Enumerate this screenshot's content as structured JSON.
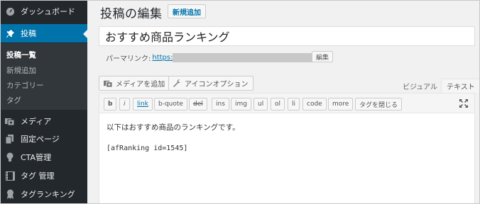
{
  "sidebar": {
    "dashboard": "ダッシュボード",
    "posts": "投稿",
    "sub": [
      "投稿一覧",
      "新規追加",
      "カテゴリー",
      "タグ"
    ],
    "media": "メディア",
    "pages": "固定ページ",
    "cta": "CTA管理",
    "tags": "タグ 管理",
    "tag_ranking": "タグランキング"
  },
  "header": {
    "title": "投稿の編集",
    "add_new": "新規追加"
  },
  "post": {
    "title": "おすすめ商品ランキング",
    "permalink_label": "パーマリンク:",
    "permalink_url": "https:",
    "edit_button": "編集"
  },
  "editor": {
    "add_media": "メディアを追加",
    "icon_option": "アイコンオプション",
    "tab_visual": "ビジュアル",
    "tab_text": "テキスト",
    "quicktags": [
      "b",
      "i",
      "link",
      "b-quote",
      "del",
      "ins",
      "img",
      "ul",
      "ol",
      "li",
      "code",
      "more",
      "タグを閉じる"
    ],
    "content_line1": "以下はおすすめ商品のランキングです。",
    "content_line2": "[afRanking id=1545]"
  },
  "colors": {
    "sidebar_bg": "#23282d",
    "active_bg": "#0073aa",
    "link": "#0073aa"
  }
}
